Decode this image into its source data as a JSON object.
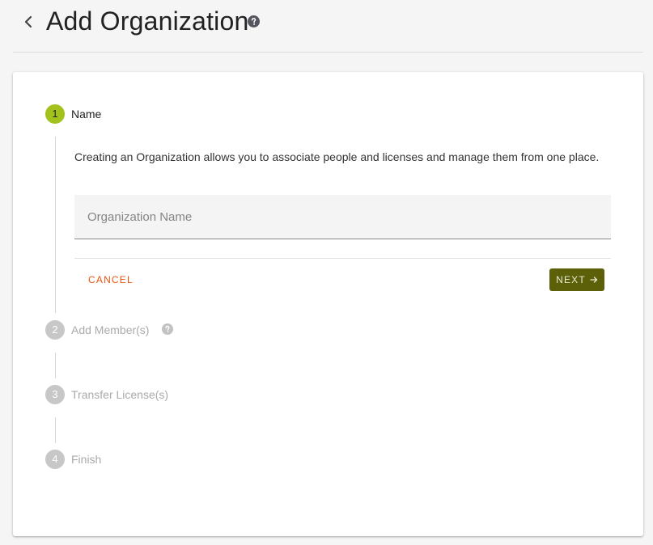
{
  "header": {
    "title": "Add Organization",
    "back_icon": "chevron-left-icon",
    "help_icon": "question-circle-icon"
  },
  "stepper": {
    "steps": [
      {
        "number": "1",
        "label": "Name",
        "state": "active"
      },
      {
        "number": "2",
        "label": "Add Member(s)",
        "state": "inactive",
        "help_icon": "question-circle-icon"
      },
      {
        "number": "3",
        "label": "Transfer License(s)",
        "state": "inactive"
      },
      {
        "number": "4",
        "label": "Finish",
        "state": "inactive"
      }
    ]
  },
  "name_step": {
    "description": "Creating an Organization allows you to associate people and licenses and manage them from one place.",
    "input_value": "",
    "input_placeholder": "Organization Name",
    "cancel_label": "CANCEL",
    "next_label": "NEXT",
    "next_icon": "arrow-right-icon"
  },
  "colors": {
    "active_step": "#a4c21d",
    "inactive_step": "#c7c7c7",
    "cancel_text": "#e8530e",
    "next_button": "#5c6109",
    "background": "#f5f5f5"
  }
}
